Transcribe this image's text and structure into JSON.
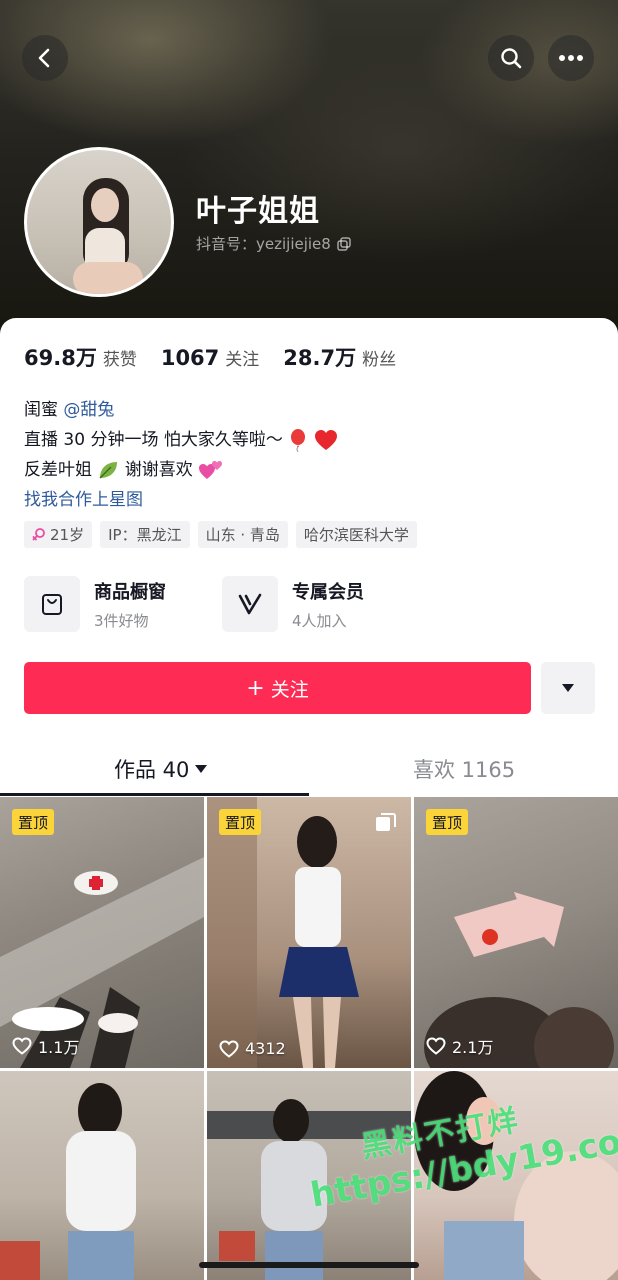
{
  "profile": {
    "name": "叶子姐姐",
    "douyin_id": "抖音号：yezijiejie8"
  },
  "stats": [
    {
      "value": "69.8万",
      "label": "获赞"
    },
    {
      "value": "1067",
      "label": "关注"
    },
    {
      "value": "28.7万",
      "label": "粉丝"
    }
  ],
  "bio": {
    "line1_prefix": "闺蜜",
    "line1_mention": "@甜兔",
    "line2": "直播 30 分钟一场 怕大家久等啦～",
    "line3_a": "反差叶姐",
    "line3_b": "谢谢喜欢",
    "link": "找我合作上星图"
  },
  "tags": [
    "21岁",
    "IP：黑龙江",
    "山东 · 青岛",
    "哈尔滨医科大学"
  ],
  "features": [
    {
      "title": "商品橱窗",
      "subtitle": "3件好物",
      "icon": "shopping-bag-icon"
    },
    {
      "title": "专属会员",
      "subtitle": "4人加入",
      "icon": "vip-v-icon"
    }
  ],
  "actions": {
    "follow_label": "关注",
    "follow_plus": "+"
  },
  "tabs": [
    {
      "label": "作品 40"
    },
    {
      "label": "喜欢 1165"
    }
  ],
  "videos": [
    {
      "pinned": "置顶",
      "likes": "1.1万"
    },
    {
      "pinned": "置顶",
      "likes": "4312"
    },
    {
      "pinned": "置顶",
      "likes": "2.1万"
    },
    {
      "pinned": "",
      "likes": ""
    },
    {
      "pinned": "",
      "likes": ""
    },
    {
      "pinned": "",
      "likes": ""
    }
  ],
  "watermark": {
    "line1": "黑料不打烊",
    "line2": "https://bdy19.co"
  },
  "colors": {
    "follow": "#fe2c55",
    "pin": "#fbd43a",
    "link": "#2f5b9c"
  }
}
